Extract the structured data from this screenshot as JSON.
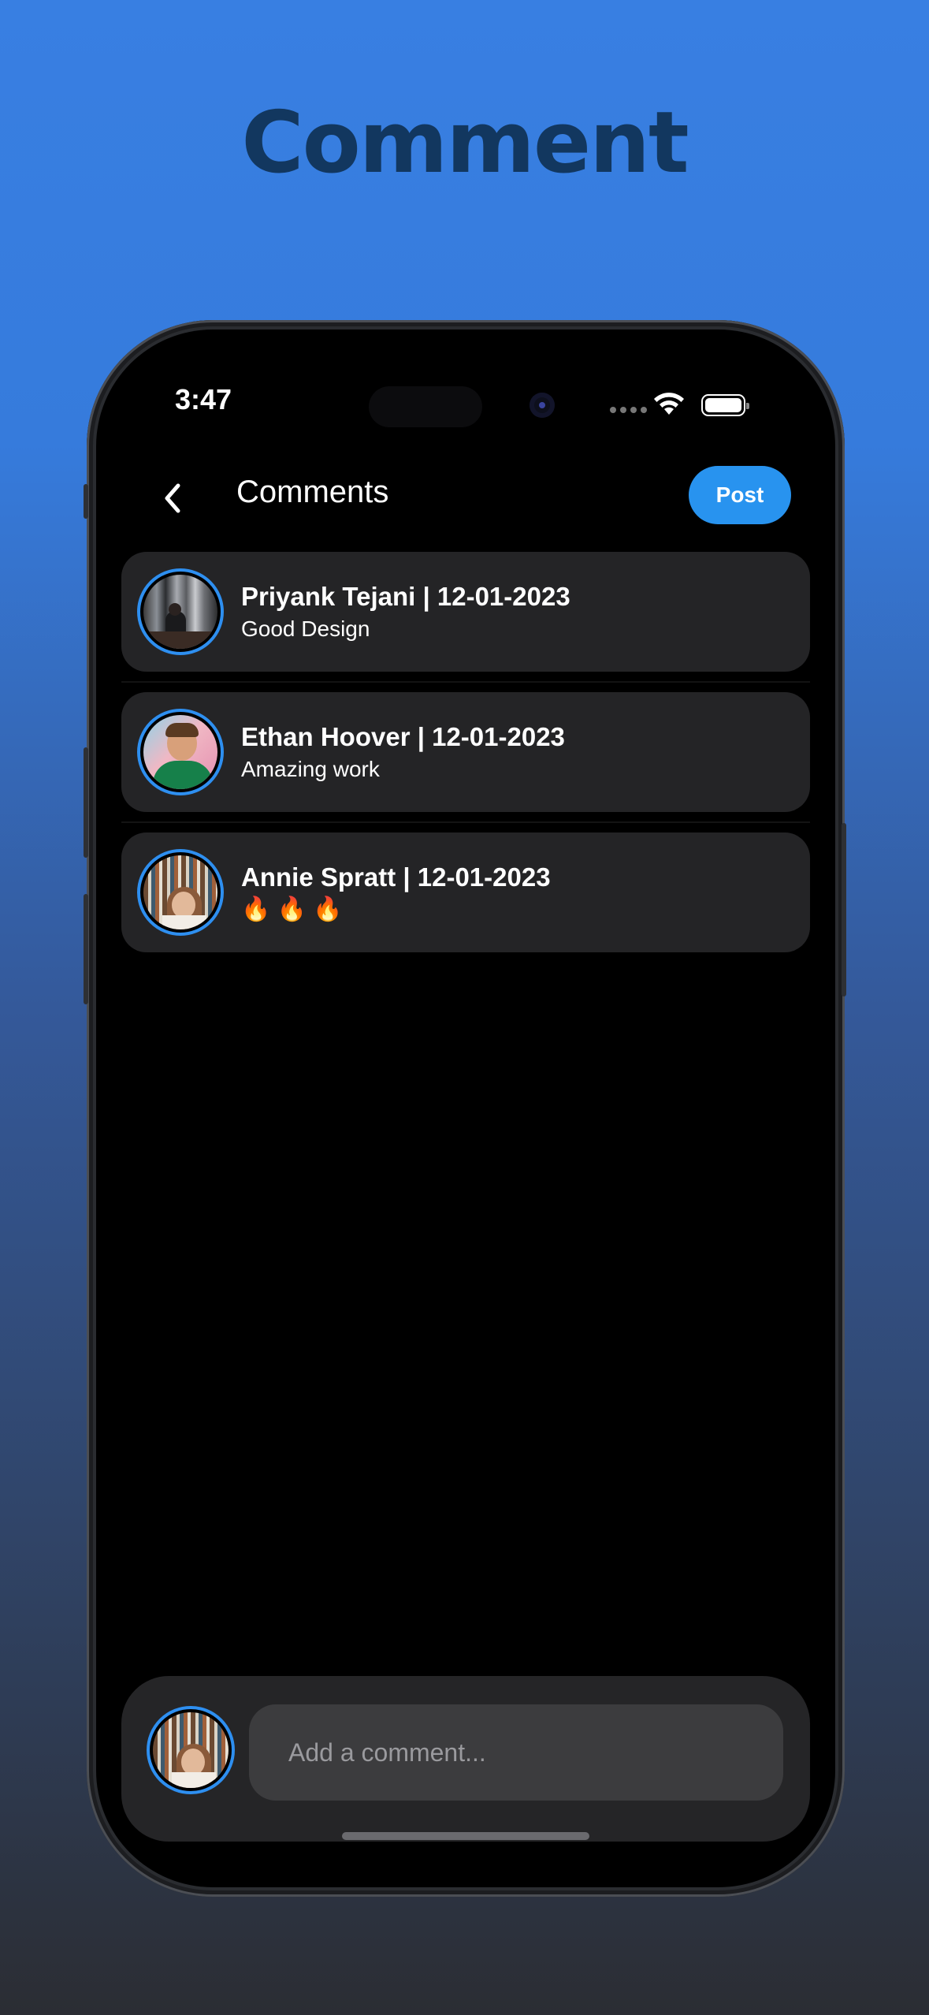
{
  "page_title": "Comment",
  "status_bar": {
    "time": "3:47"
  },
  "nav": {
    "title": "Comments",
    "post_label": "Post"
  },
  "comments": [
    {
      "author": "Priyank Tejani",
      "date": "12-01-2023",
      "header": "Priyank Tejani | 12-01-2023",
      "text": "Good Design"
    },
    {
      "author": "Ethan Hoover",
      "date": "12-01-2023",
      "header": "Ethan Hoover | 12-01-2023",
      "text": "Amazing work"
    },
    {
      "author": "Annie Spratt",
      "date": "12-01-2023",
      "header": "Annie Spratt | 12-01-2023",
      "text": "🔥 🔥 🔥"
    }
  ],
  "composer": {
    "placeholder": "Add a comment..."
  },
  "colors": {
    "accent": "#2893ef",
    "background_top": "#387fe2",
    "background_bottom": "#2b2d33",
    "card": "#242426"
  },
  "icons": {
    "back": "chevron-left-icon",
    "wifi": "wifi-icon",
    "battery": "battery-icon"
  }
}
